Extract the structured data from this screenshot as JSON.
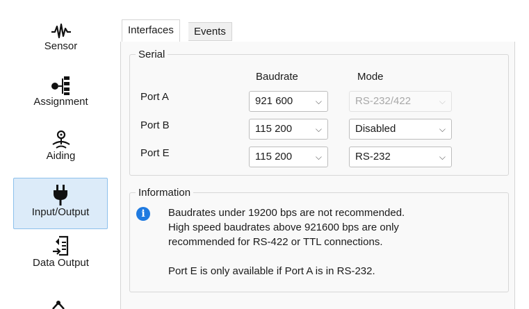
{
  "sidebar": {
    "items": [
      {
        "label": "Sensor",
        "icon": "waveform-icon"
      },
      {
        "label": "Assignment",
        "icon": "tree-icon"
      },
      {
        "label": "Aiding",
        "icon": "satellite-icon"
      },
      {
        "label": "Input/Output",
        "icon": "plug-icon",
        "active": true
      },
      {
        "label": "Data Output",
        "icon": "data-output-icon"
      }
    ]
  },
  "tabs": [
    {
      "label": "Interfaces",
      "active": true
    },
    {
      "label": "Events",
      "active": false
    }
  ],
  "serial": {
    "title": "Serial",
    "col_baudrate": "Baudrate",
    "col_mode": "Mode",
    "ports": [
      {
        "label": "Port A",
        "baudrate": "921 600",
        "mode": "RS-232/422",
        "mode_enabled": false
      },
      {
        "label": "Port B",
        "baudrate": "115 200",
        "mode": "Disabled",
        "mode_enabled": true
      },
      {
        "label": "Port E",
        "baudrate": "115 200",
        "mode": "RS-232",
        "mode_enabled": true
      }
    ]
  },
  "information": {
    "title": "Information",
    "lines": [
      "Baudrates under 19200 bps are not recommended.",
      "High speed baudrates above 921600 bps are only",
      "recommended for RS-422 or TTL connections.",
      "",
      "Port E is only available if Port A is in RS-232."
    ]
  },
  "colors": {
    "accent": "#1f7ae0",
    "active_nav_bg": "#dcebf9",
    "active_nav_border": "#8cc0ec"
  }
}
